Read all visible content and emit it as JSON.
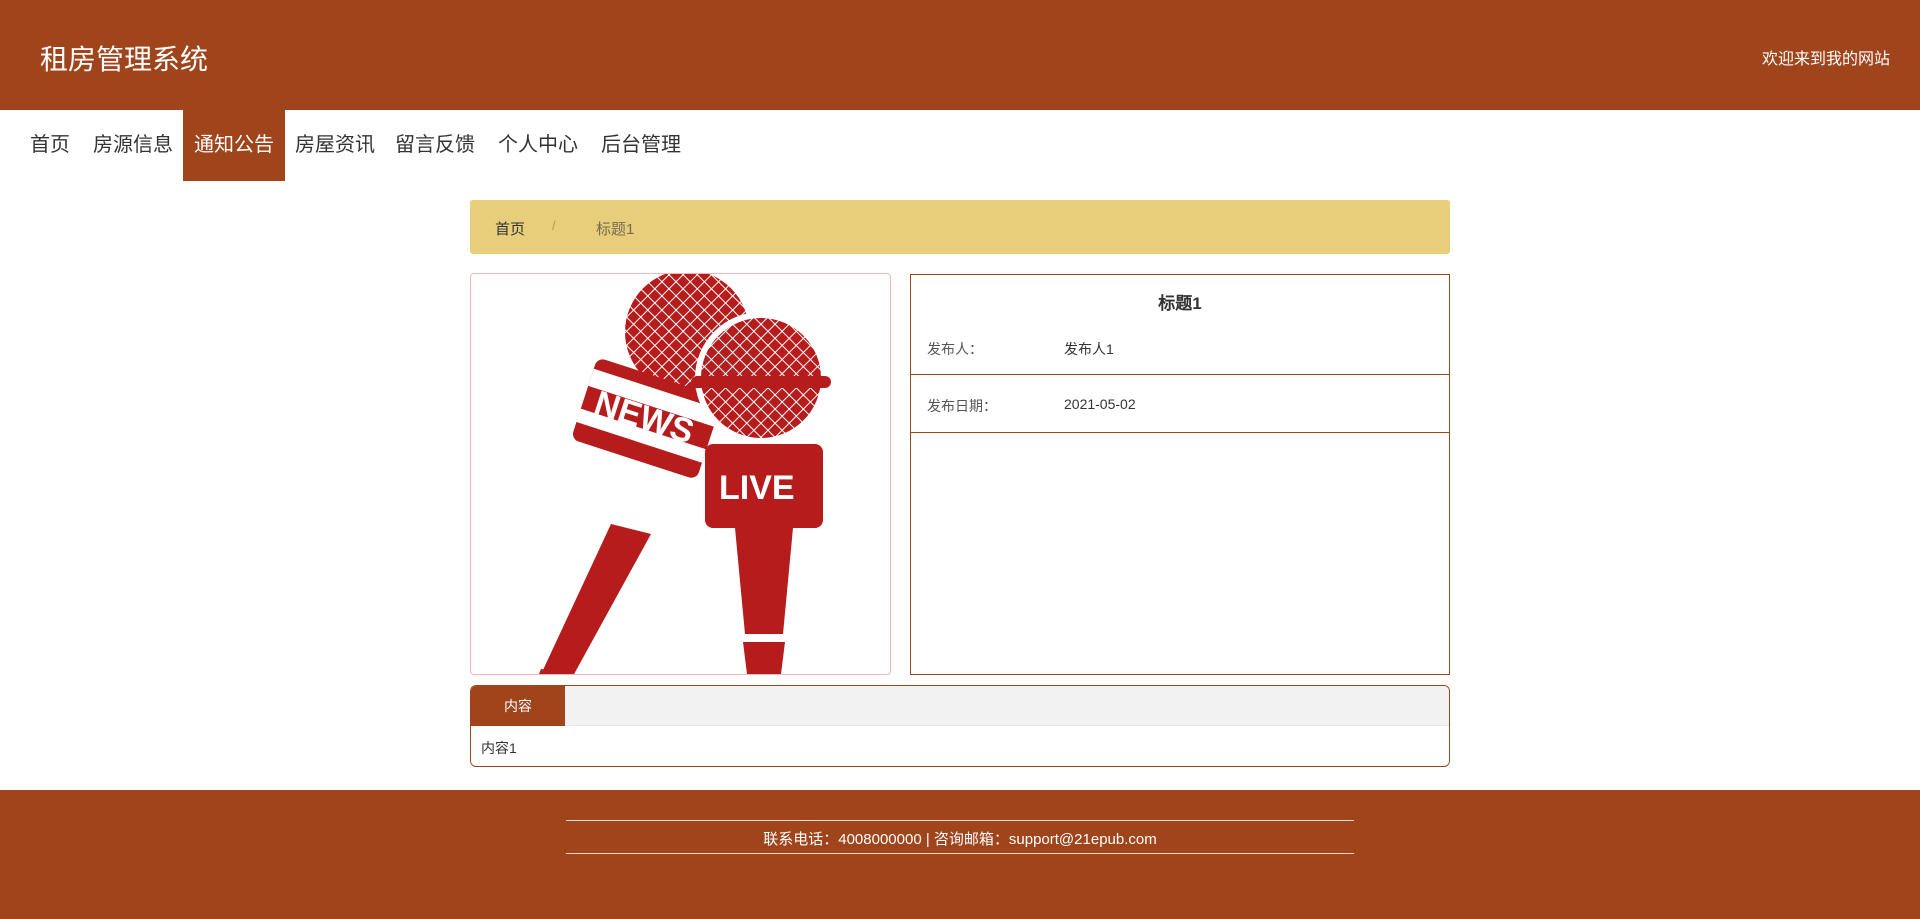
{
  "header": {
    "site_title": "租房管理系统",
    "welcome": "欢迎来到我的网站",
    "background": "#a0441b"
  },
  "nav": {
    "items": [
      {
        "label": "首页",
        "active": false
      },
      {
        "label": "房源信息",
        "active": false
      },
      {
        "label": "通知公告",
        "active": true
      },
      {
        "label": "房屋资讯",
        "active": false
      },
      {
        "label": "留言反馈",
        "active": false
      },
      {
        "label": "个人中心",
        "active": false
      },
      {
        "label": "后台管理",
        "active": false
      }
    ]
  },
  "breadcrumb": {
    "home": "首页",
    "separator": "/",
    "current": "标题1"
  },
  "image": {
    "icon": "news-live-microphones-illustration",
    "news_text": "NEWS",
    "live_text": "LIVE",
    "color": "#b71c1c"
  },
  "detail": {
    "title": "标题1",
    "publisher_label": "发布人：",
    "publisher_value": "发布人1",
    "date_label": "发布日期：",
    "date_value": "2021-05-02"
  },
  "content": {
    "tab_label": "内容",
    "text": "内容1"
  },
  "footer": {
    "text": "联系电话：4008000000 | 咨询邮箱：support@21epub.com"
  }
}
